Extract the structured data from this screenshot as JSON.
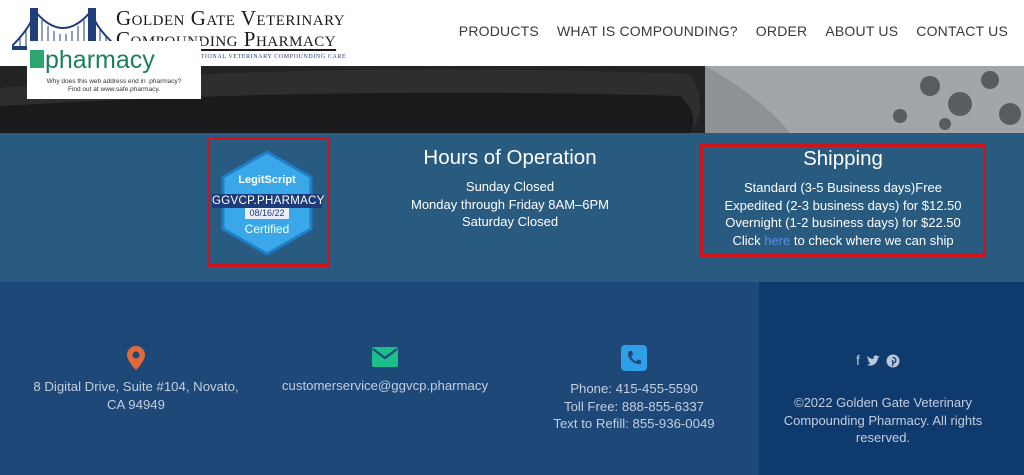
{
  "header": {
    "logo_line1": "Golden Gate Veterinary",
    "logo_line2": "Compounding Pharmacy",
    "logo_tagline": "Your bridge to exceptional veterinary compounding care",
    "nav": [
      "PRODUCTS",
      "WHAT IS COMPOUNDING?",
      "ORDER",
      "ABOUT US",
      "CONTACT US"
    ]
  },
  "badges": {
    "pharmacy_word": "pharmacy",
    "pharmacy_line1": "Why does this web address end in .pharmacy?",
    "pharmacy_line2": "Find out at www.safe.pharmacy.",
    "legit_brand": "LegitScript",
    "legit_domain": "GGVCP.PHARMACY",
    "legit_date": "08/16/22",
    "legit_status": "Certified"
  },
  "hours": {
    "title": "Hours of Operation",
    "lines": [
      "Sunday Closed",
      "Monday through Friday 8AM–6PM",
      "Saturday Closed"
    ]
  },
  "shipping": {
    "title": "Shipping",
    "lines": [
      "Standard (3-5 Business days)Free",
      "Expedited (2-3 business days) for $12.50",
      "Overnight (1-2 business days) for $22.50"
    ],
    "click_prefix": "Click ",
    "link_text": "here",
    "click_suffix": " to check where we can ship"
  },
  "footer": {
    "address_line1": "8 Digital Drive, Suite #104, Novato,",
    "address_line2": "CA 94949",
    "email": "customerservice@ggvcp.pharmacy",
    "phone": "Phone: 415-455-5590",
    "tollfree": "Toll Free: 888-855-6337",
    "refill": "Text to Refill: 855-936-0049",
    "copyright_line1": "©2022 Golden Gate Veterinary",
    "copyright_line2": "Compounding Pharmacy. All rights",
    "copyright_line3": "reserved.",
    "social": [
      "facebook-icon",
      "twitter-icon",
      "pinterest-icon"
    ]
  },
  "colors": {
    "band": "#295a80",
    "footer": "#1e4877",
    "footer_right": "#0f3a6e",
    "highlight": "#d0121b",
    "link": "#5b8ee6",
    "location_icon": "#e06a3b",
    "email_icon": "#1bbf8a",
    "phone_icon": "#2fa0e8"
  }
}
